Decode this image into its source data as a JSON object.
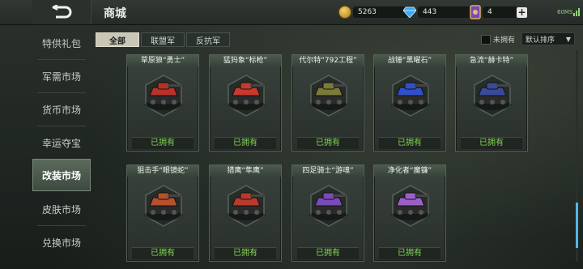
{
  "header": {
    "title": "商城"
  },
  "resources": {
    "coins": "5263",
    "gems": "443",
    "tickets": "4",
    "ping": "60MS"
  },
  "sidebar": {
    "items": [
      {
        "label": "特供礼包"
      },
      {
        "label": "军需市场"
      },
      {
        "label": "货币市场"
      },
      {
        "label": "幸运夺宝"
      },
      {
        "label": "改装市场"
      },
      {
        "label": "皮肤市场"
      },
      {
        "label": "兑换市场"
      }
    ],
    "active_index": 4
  },
  "tabs": [
    {
      "label": "全部"
    },
    {
      "label": "联盟军"
    },
    {
      "label": "反抗军"
    }
  ],
  "filter": {
    "owned_label": "未拥有",
    "sort_label": "默认排序"
  },
  "cards": [
    {
      "name": "草原狼“勇士”",
      "status": "已拥有",
      "icon": "red-tank-icon",
      "color": "#b8322a"
    },
    {
      "name": "猛犸象“标枪”",
      "status": "已拥有",
      "icon": "heavy-tank-icon",
      "color": "#c83a2e"
    },
    {
      "name": "代尔特“792工程”",
      "status": "已拥有",
      "icon": "olive-tank-icon",
      "color": "#7a7a3a"
    },
    {
      "name": "战锤“黑曜石”",
      "status": "已拥有",
      "icon": "blue-tank-icon",
      "color": "#3050c8"
    },
    {
      "name": "急流“赫卡特”",
      "status": "已拥有",
      "icon": "artillery-tank-icon",
      "color": "#3a4a9a"
    },
    {
      "name": "狙击手“眼镜蛇”",
      "status": "已拥有",
      "icon": "sniper-mech-icon",
      "color": "#b8502a"
    },
    {
      "name": "猎鹰“隼鹰”",
      "status": "已拥有",
      "icon": "falcon-jet-icon",
      "color": "#b83a2a"
    },
    {
      "name": "四足骑士“游魂”",
      "status": "已拥有",
      "icon": "spider-mech-icon",
      "color": "#7a4ab8"
    },
    {
      "name": "净化者“魔镰”",
      "status": "已拥有",
      "icon": "buggy-icon",
      "color": "#9a60c8"
    }
  ],
  "colors": {
    "owned_text": "#84d456",
    "accent_scroll": "#4fb8e8",
    "active_tab": "#c9c7b8"
  }
}
